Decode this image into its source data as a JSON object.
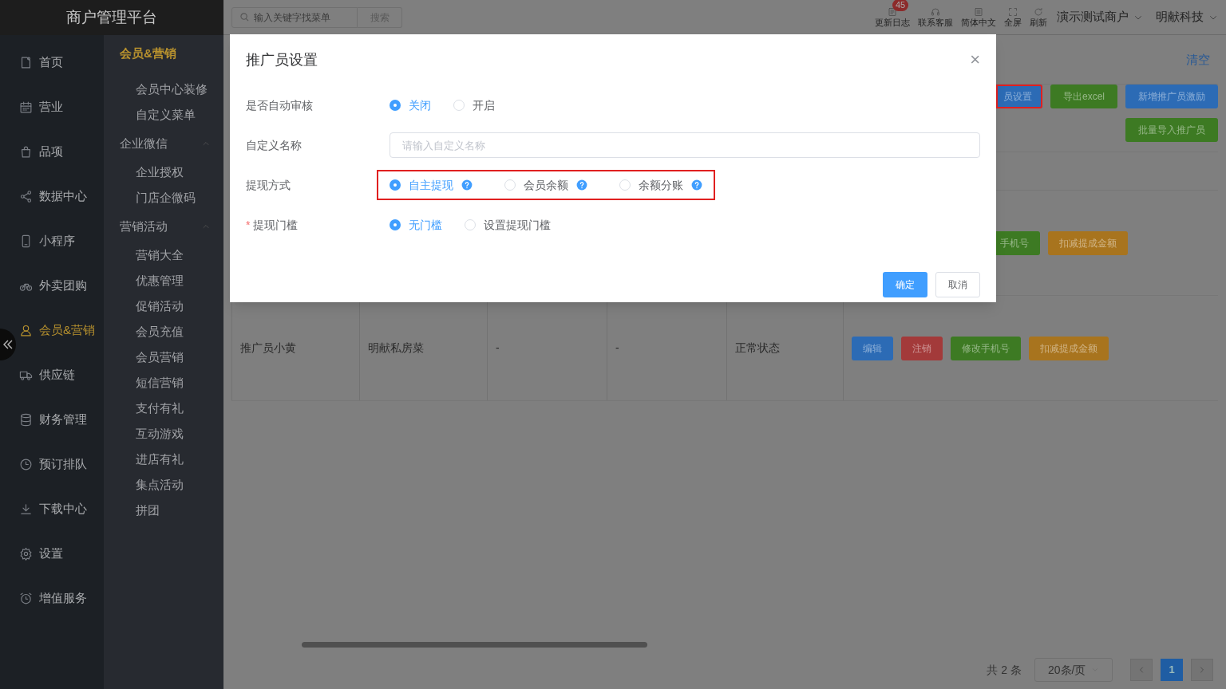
{
  "app_title": "商户管理平台",
  "nav": [
    {
      "label": "首页",
      "selected": false
    },
    {
      "label": "营业",
      "selected": false
    },
    {
      "label": "品项",
      "selected": false
    },
    {
      "label": "数据中心",
      "selected": false
    },
    {
      "label": "小程序",
      "selected": false
    },
    {
      "label": "外卖团购",
      "selected": false
    },
    {
      "label": "会员&营销",
      "selected": true
    },
    {
      "label": "供应链",
      "selected": false
    },
    {
      "label": "财务管理",
      "selected": false
    },
    {
      "label": "预订排队",
      "selected": false
    },
    {
      "label": "下载中心",
      "selected": false
    },
    {
      "label": "设置",
      "selected": false
    },
    {
      "label": "增值服务",
      "selected": false
    }
  ],
  "submenu": {
    "title": "会员&营销",
    "items": [
      {
        "label": "会员中心装修"
      },
      {
        "label": "自定义菜单"
      },
      {
        "label": "企业微信",
        "expanded": true,
        "children": [
          {
            "label": "企业授权"
          },
          {
            "label": "门店企微码"
          }
        ]
      },
      {
        "label": "营销活动",
        "expanded": true,
        "children": [
          {
            "label": "营销大全"
          },
          {
            "label": "优惠管理"
          },
          {
            "label": "促销活动"
          },
          {
            "label": "会员充值"
          },
          {
            "label": "会员营销"
          },
          {
            "label": "短信营销"
          },
          {
            "label": "支付有礼"
          },
          {
            "label": "互动游戏"
          },
          {
            "label": "进店有礼"
          },
          {
            "label": "集点活动"
          },
          {
            "label": "拼团"
          }
        ]
      }
    ]
  },
  "topbar": {
    "search": {
      "placeholder": "输入关键字找菜单",
      "button": "搜索"
    },
    "tools": [
      {
        "label": "更新日志",
        "badge": "45"
      },
      {
        "label": "联系客服"
      },
      {
        "label": "简体中文"
      },
      {
        "label": "全屏"
      },
      {
        "label": "刷新"
      }
    ],
    "menus": [
      "演示测试商户",
      "明献科技"
    ]
  },
  "clear_link": "清空",
  "toolbar": [
    {
      "label": "员设置",
      "color": "#2c6bb5",
      "highlighted": true
    },
    {
      "label": "导出excel",
      "color": "#3d7a23",
      "highlighted": false
    },
    {
      "label": "新增推广员激励",
      "color": "#2c6bb5",
      "highlighted": false
    }
  ],
  "toolbar_row2": [
    {
      "label": "批量导入推广员",
      "color": "#3d7a23"
    }
  ],
  "table": {
    "rows": [
      {
        "cells": [],
        "actions": [
          {
            "label": "手机号",
            "color": "#3d7a23"
          },
          {
            "label": "扣减提成金额",
            "color": "#a8741e"
          }
        ]
      },
      {
        "cells": [
          "推广员小黄",
          "明献私房菜",
          "-",
          "-",
          "正常状态"
        ],
        "actions": [
          {
            "label": "编辑",
            "color": "#2c6bb5"
          },
          {
            "label": "注销",
            "color": "#a33a3a"
          },
          {
            "label": "修改手机号",
            "color": "#3d7a23"
          },
          {
            "label": "扣减提成金额",
            "color": "#a8741e"
          }
        ]
      }
    ]
  },
  "pagination": {
    "total": "共 2 条",
    "page_size": "20条/页",
    "pages": [
      {
        "label": "1",
        "selected": true
      }
    ]
  },
  "dialog": {
    "title": "推广员设置",
    "close": "×",
    "fields": [
      {
        "kind": "radio",
        "label": "是否自动审核",
        "options": [
          {
            "label": "关闭",
            "selected": true,
            "help": false
          },
          {
            "label": "开启",
            "selected": false,
            "help": false
          }
        ]
      },
      {
        "kind": "text",
        "label": "自定义名称",
        "placeholder": "请输入自定义名称"
      },
      {
        "kind": "radio",
        "label": "提现方式",
        "highlighted": true,
        "options": [
          {
            "label": "自主提现",
            "selected": true,
            "help": true
          },
          {
            "label": "会员余额",
            "selected": false,
            "help": true
          },
          {
            "label": "余额分账",
            "selected": false,
            "help": true
          }
        ]
      },
      {
        "kind": "radio",
        "label": "提现门槛",
        "required_mark": "*",
        "options": [
          {
            "label": "无门槛",
            "selected": true,
            "help": false
          },
          {
            "label": "设置提现门槛",
            "selected": false,
            "help": false
          }
        ]
      }
    ],
    "buttons": [
      {
        "label": "确定",
        "primary": true
      },
      {
        "label": "取消",
        "primary": false
      }
    ]
  }
}
